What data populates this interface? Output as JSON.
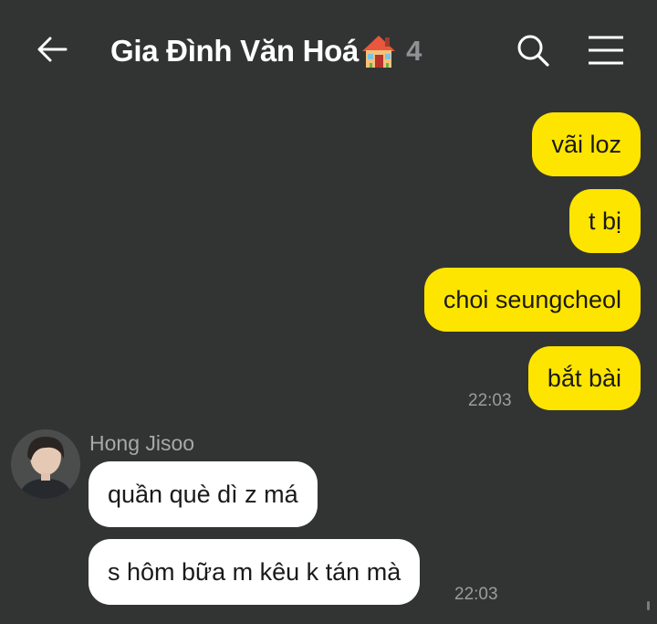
{
  "header": {
    "title": "Gia Đình Văn Hoá",
    "member_count": "4",
    "back_icon": "arrow-left-icon",
    "search_icon": "search-icon",
    "menu_icon": "hamburger-menu-icon",
    "title_emoji": "house-emoji"
  },
  "colors": {
    "background": "#323433",
    "outgoing_bubble": "#fee500",
    "incoming_bubble": "#ffffff",
    "timestamp": "#9a9d9e"
  },
  "outgoing": {
    "messages": [
      "vãi loz",
      "t bị",
      "choi seungcheol",
      "bắt bài"
    ],
    "time": "22:03"
  },
  "incoming": {
    "sender": "Hong Jisoo",
    "messages": [
      "quần què dì z má",
      "s hôm bữa m kêu k tán mà"
    ],
    "time": "22:03"
  }
}
